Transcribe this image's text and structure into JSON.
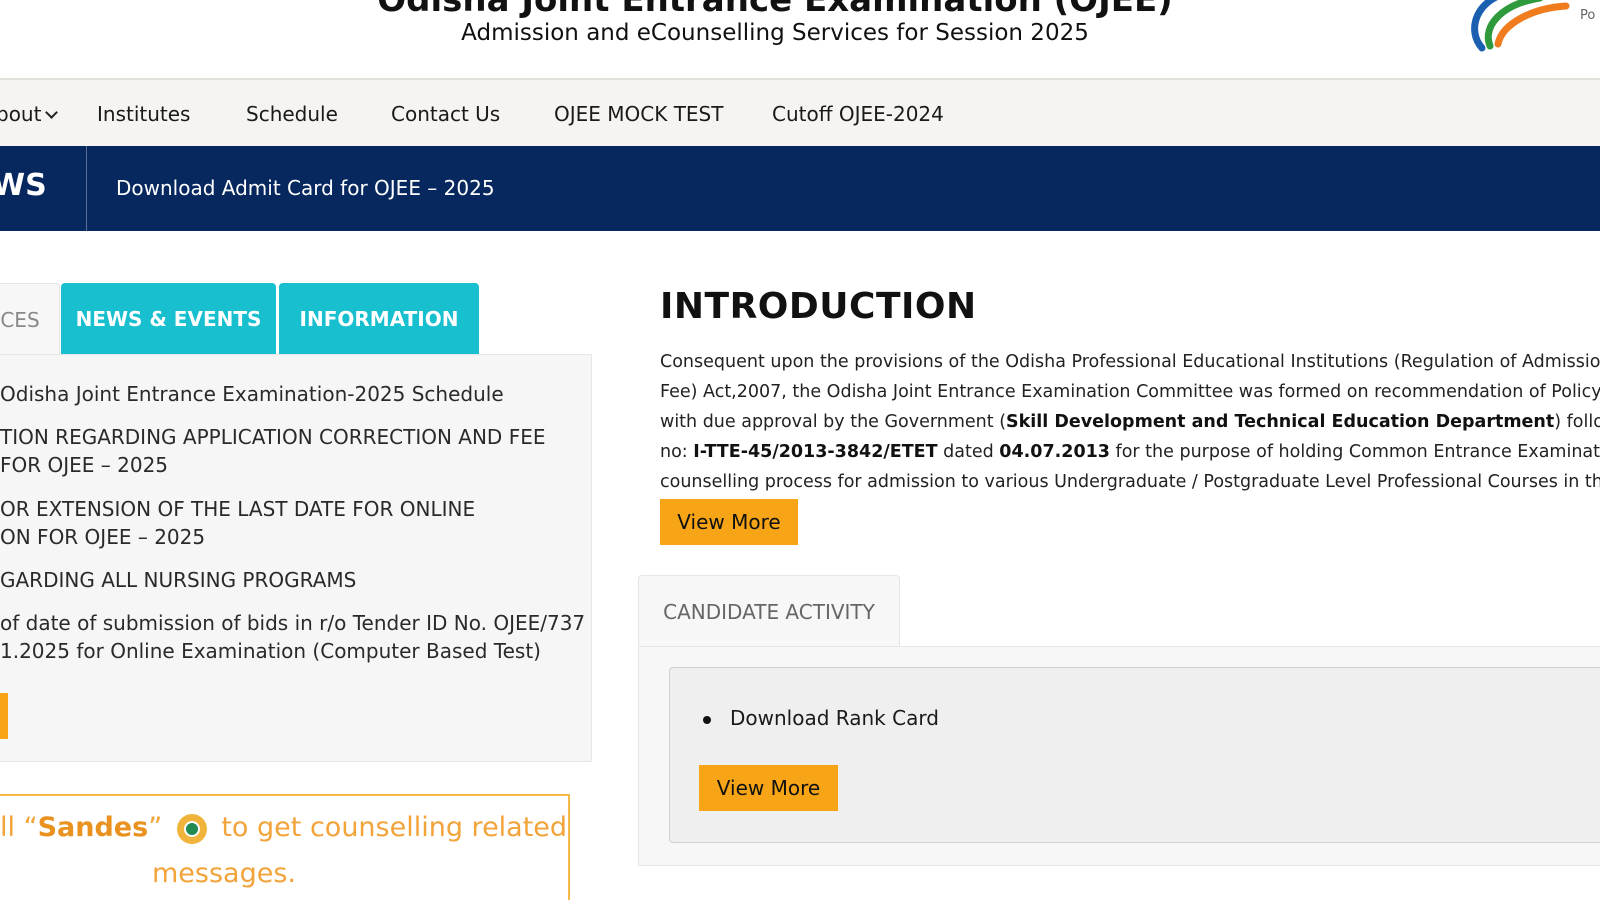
{
  "header": {
    "title": "Odisha Joint Entrance Examination (OJEE)",
    "subtitle": "Admission and eCounselling Services for Session 2025",
    "powered_by": "Po"
  },
  "nav": {
    "items": [
      {
        "label": "bout",
        "has_dropdown": true
      },
      {
        "label": "Institutes"
      },
      {
        "label": "Schedule"
      },
      {
        "label": "Contact Us"
      },
      {
        "label": "OJEE MOCK TEST"
      },
      {
        "label": "Cutoff OJEE-2024"
      }
    ]
  },
  "news": {
    "label": "WS",
    "headline": "Download Admit Card for OJEE – 2025"
  },
  "left_tabs": {
    "tabs": [
      {
        "label": "CES",
        "active": false
      },
      {
        "label": "NEWS & EVENTS",
        "active": true
      },
      {
        "label": "INFORMATION",
        "active": true
      }
    ],
    "notices": [
      {
        "lines": [
          "Odisha Joint Entrance Examination-2025 Schedule"
        ]
      },
      {
        "lines": [
          "TION REGARDING APPLICATION CORRECTION AND FEE",
          "FOR OJEE – 2025"
        ]
      },
      {
        "lines": [
          "OR EXTENSION OF THE LAST DATE FOR ONLINE",
          "ON FOR OJEE – 2025"
        ]
      },
      {
        "lines": [
          "GARDING ALL NURSING PROGRAMS"
        ]
      },
      {
        "lines": [
          "of date of submission of bids in r/o Tender ID No. OJEE/737",
          "1.2025 for Online Examination (Computer Based Test)"
        ]
      }
    ]
  },
  "sandes": {
    "prefix": "ll “",
    "brand": "Sandes",
    "suffix": "” ",
    "after_icon": " to get counselling related",
    "line2": "messages."
  },
  "introduction": {
    "title": "INTRODUCTION",
    "lines": [
      {
        "parts": [
          {
            "t": "Consequent upon the provisions of the Odisha Professional Educational Institutions (Regulation of Admission and"
          }
        ]
      },
      {
        "parts": [
          {
            "t": "Fee) Act,2007, the Odisha Joint Entrance Examination Committee was formed on recommendation of Policy Plan"
          }
        ]
      },
      {
        "parts": [
          {
            "t": "with due approval by the Government ("
          },
          {
            "t": "Skill Development and Technical Education Department",
            "b": true
          },
          {
            "t": ") following the"
          }
        ]
      },
      {
        "parts": [
          {
            "t": "no: "
          },
          {
            "t": "I-TTE-45/2013-3842/ETET",
            "b": true
          },
          {
            "t": " dated "
          },
          {
            "t": "04.07.2013",
            "b": true
          },
          {
            "t": " for the purpose of holding Common Entrance Examinations and"
          }
        ]
      },
      {
        "parts": [
          {
            "t": "counselling process for admission to various Undergraduate / Postgraduate Level Professional Courses in the State"
          }
        ]
      }
    ],
    "view_more": "View More"
  },
  "candidate_activity": {
    "tab_label": "CANDIDATE ACTIVITY",
    "items": [
      "Download Rank Card"
    ],
    "view_more": "View More"
  },
  "colors": {
    "navy": "#06285f",
    "teal": "#17bfcf",
    "orange": "#f7a416",
    "sandes_text": "#f2a33a"
  }
}
